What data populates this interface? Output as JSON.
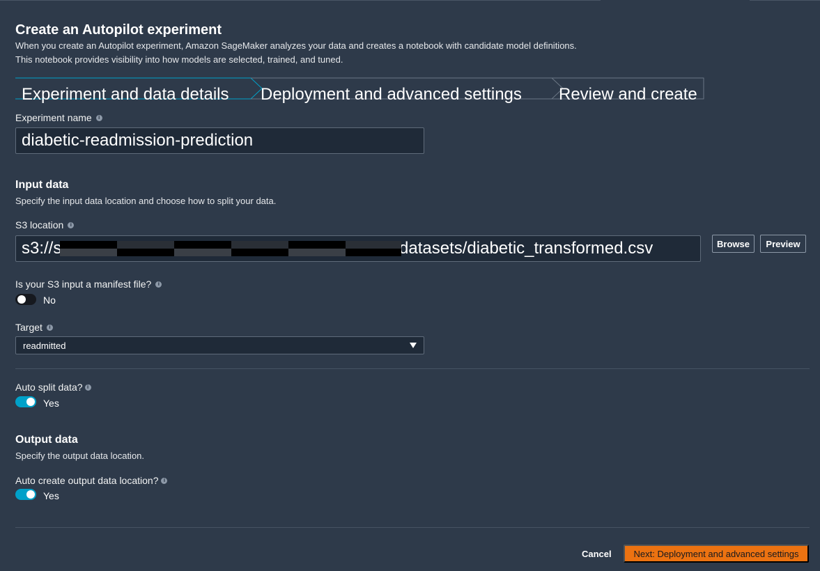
{
  "header": {
    "title": "Create an Autopilot experiment",
    "description_line1": "When you create an Autopilot experiment, Amazon SageMaker analyzes your data and creates a notebook with candidate model definitions.",
    "description_line2": "This notebook provides visibility into how models are selected, trained, and tuned."
  },
  "steps": [
    {
      "label": "Experiment and data details",
      "active": true
    },
    {
      "label": "Deployment and advanced settings",
      "active": false
    },
    {
      "label": "Review and create",
      "active": false
    }
  ],
  "experiment_name": {
    "label": "Experiment name",
    "value": "diabetic-readmission-prediction"
  },
  "input_data": {
    "title": "Input data",
    "description": "Specify the input data location and choose how to split your data.",
    "s3_location_label": "S3 location",
    "s3_prefix": "s3://s",
    "s3_suffix": "/datasets/diabetic_transformed.csv",
    "browse_label": "Browse",
    "preview_label": "Preview",
    "manifest_label": "Is your S3 input a manifest file?",
    "manifest_value": "No",
    "target_label": "Target",
    "target_value": "readmitted"
  },
  "auto_split": {
    "label": "Auto split data?",
    "value": "Yes"
  },
  "output_data": {
    "title": "Output data",
    "description": "Specify the output data location.",
    "auto_create_label": "Auto create output data location?",
    "auto_create_value": "Yes"
  },
  "footer": {
    "cancel_label": "Cancel",
    "next_label": "Next: Deployment and advanced settings"
  },
  "colors": {
    "background": "#2e3a4a",
    "accent": "#00a1c9",
    "primary_button": "#ec7211"
  }
}
